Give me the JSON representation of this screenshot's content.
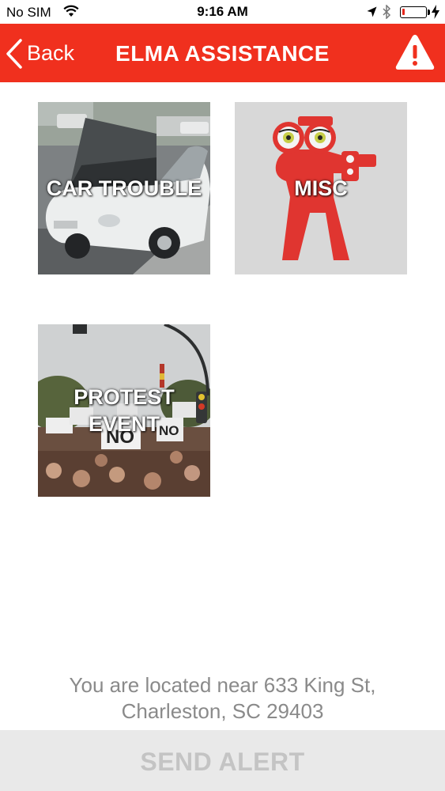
{
  "status_bar": {
    "carrier": "No SIM",
    "time": "9:16 AM",
    "battery_level": 0.12,
    "battery_color": "#e4261b"
  },
  "nav": {
    "back_label": "Back",
    "title": "ELMA ASSISTANCE",
    "alert_icon": "warning-triangle-icon",
    "bar_color": "#f0301e"
  },
  "tiles": [
    {
      "label": "CAR TROUBLE",
      "image": "car-with-open-hood-photo"
    },
    {
      "label": "MISC",
      "image": "elma-mascot-with-binoculars-and-camera"
    },
    {
      "label": "PROTEST EVENT",
      "image": "protest-crowd-with-no-signs-photo"
    }
  ],
  "location": {
    "text": "You are located near 633 King St, Charleston, SC 29403"
  },
  "send_alert": {
    "label": "SEND ALERT"
  }
}
